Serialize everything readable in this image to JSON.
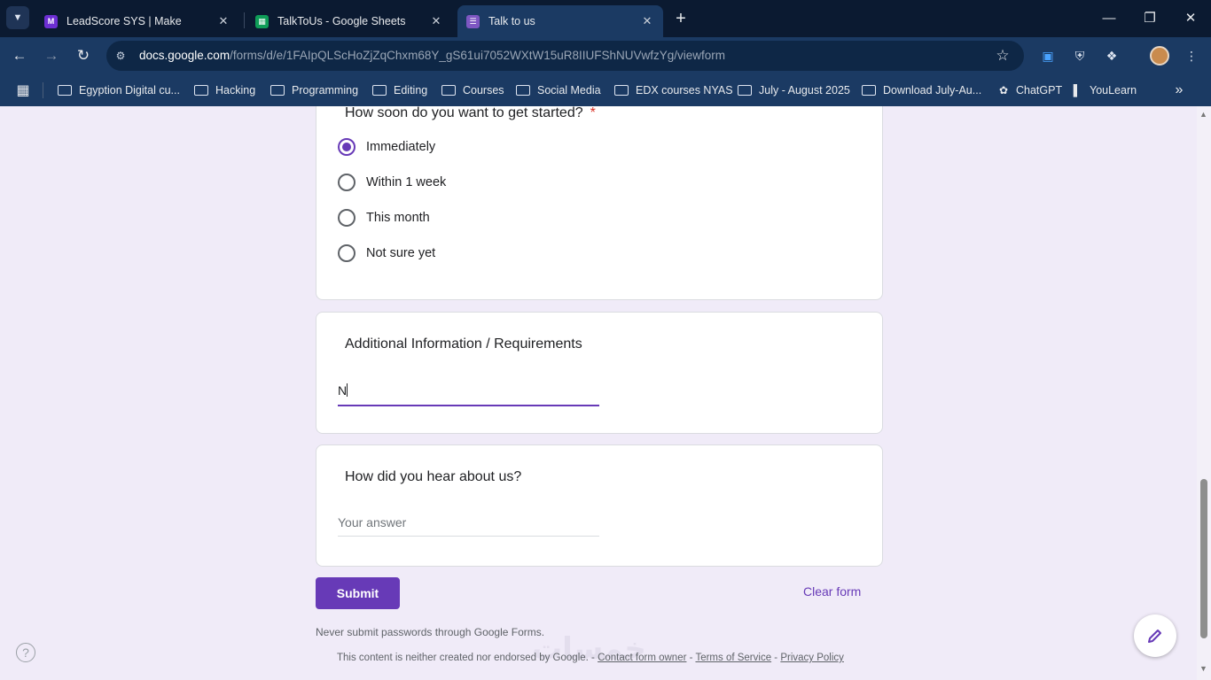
{
  "browser": {
    "tabs": [
      {
        "title": "LeadScore SYS | Make",
        "favicon": "make-favicon",
        "color": "#6d2fd3"
      },
      {
        "title": "TalkToUs - Google Sheets",
        "favicon": "sheets-favicon",
        "color": "#0f9d58"
      },
      {
        "title": "Talk to us",
        "favicon": "forms-favicon",
        "color": "#7e57c2"
      }
    ],
    "url_host": "docs.google.com",
    "url_path": "/forms/d/e/1FAIpQLScHoZjZqChxm68Y_gS61ui7052WXtW15uR8IIUFShNUVwfzYg/viewform",
    "bookmarks": [
      "Egyption Digital cu...",
      "Hacking",
      "Programming",
      "Editing",
      "Courses",
      "Social Media",
      "EDX courses NYAS",
      "July - August 2025",
      "Download July-Au...",
      "ChatGPT",
      "YouLearn"
    ]
  },
  "form": {
    "q_start": {
      "title": "How soon do you want to get started?",
      "required_mark": "*",
      "options": [
        "Immediately",
        "Within 1 week",
        "This month",
        "Not sure yet"
      ],
      "selected": "Immediately"
    },
    "q_additional": {
      "title": "Additional Information / Requirements",
      "value": "N"
    },
    "q_hear": {
      "title": "How did you hear about us?",
      "placeholder": "Your answer"
    },
    "submit_label": "Submit",
    "clear_label": "Clear form",
    "password_warning": "Never submit passwords through Google Forms.",
    "legal_text": "This content is neither created nor endorsed by Google.",
    "legal_sep": " - ",
    "contact_link": "Contact form owner",
    "terms_link": "Terms of Service",
    "privacy_link": "Privacy Policy"
  },
  "colors": {
    "accent": "#673ab7",
    "page_bg": "#f0ebf8",
    "chrome_bg": "#1b3a63"
  }
}
